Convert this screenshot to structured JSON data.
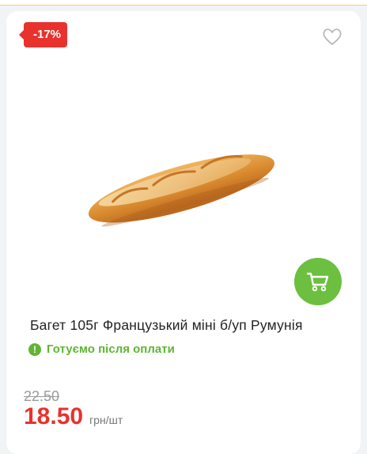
{
  "badge": {
    "discount": "-17%"
  },
  "product": {
    "title": "Багет 105г Французький міні б/уп Румунія",
    "status": "Готуємо після оплати",
    "old_price": "22.50",
    "price": "18.50",
    "unit": "грн/шт"
  },
  "icons": {
    "favorite": "heart-icon",
    "cart": "cart-icon",
    "status": "exclamation-icon"
  },
  "colors": {
    "accent_red": "#e8322e",
    "accent_green": "#6cbf3f",
    "status_green": "#5fb533"
  }
}
